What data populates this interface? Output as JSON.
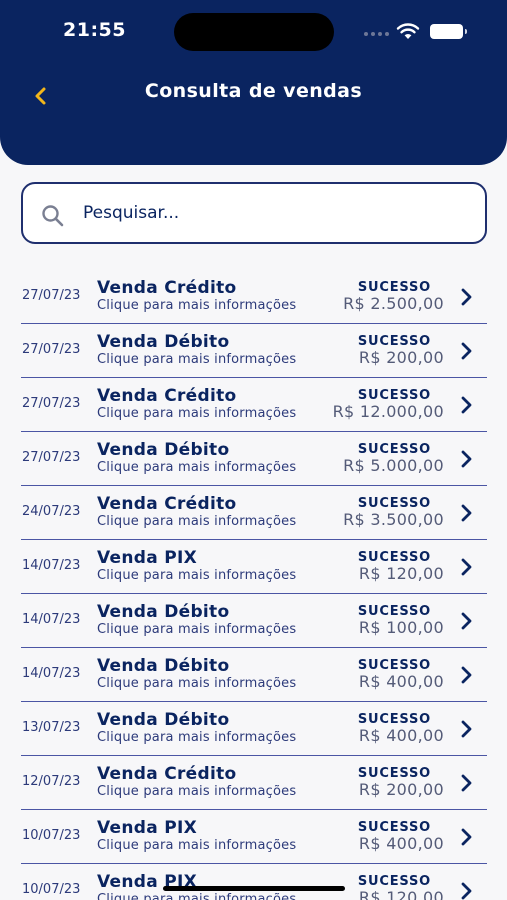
{
  "status_bar": {
    "time": "21:55"
  },
  "header": {
    "title": "Consulta de vendas"
  },
  "search": {
    "placeholder": "Pesquisar..."
  },
  "colors": {
    "primary": "#0a2460",
    "back_arrow": "#f2b61b",
    "divider": "#4b55a4"
  },
  "icons": {
    "back": "chevron-left-icon",
    "search": "search-icon",
    "row": "chevron-right-icon"
  },
  "sales": [
    {
      "date": "27/07/23",
      "type": "Venda Crédito",
      "subtitle": "Clique para mais informações",
      "status": "SUCESSO",
      "amount": "R$ 2.500,00"
    },
    {
      "date": "27/07/23",
      "type": "Venda Débito",
      "subtitle": "Clique para mais informações",
      "status": "SUCESSO",
      "amount": "R$ 200,00"
    },
    {
      "date": "27/07/23",
      "type": "Venda Crédito",
      "subtitle": "Clique para mais informações",
      "status": "SUCESSO",
      "amount": "R$ 12.000,00"
    },
    {
      "date": "27/07/23",
      "type": "Venda Débito",
      "subtitle": "Clique para mais informações",
      "status": "SUCESSO",
      "amount": "R$ 5.000,00"
    },
    {
      "date": "24/07/23",
      "type": "Venda Crédito",
      "subtitle": "Clique para mais informações",
      "status": "SUCESSO",
      "amount": "R$ 3.500,00"
    },
    {
      "date": "14/07/23",
      "type": "Venda PIX",
      "subtitle": "Clique para mais informações",
      "status": "SUCESSO",
      "amount": "R$ 120,00"
    },
    {
      "date": "14/07/23",
      "type": "Venda Débito",
      "subtitle": "Clique para mais informações",
      "status": "SUCESSO",
      "amount": "R$ 100,00"
    },
    {
      "date": "14/07/23",
      "type": "Venda Débito",
      "subtitle": "Clique para mais informações",
      "status": "SUCESSO",
      "amount": "R$ 400,00"
    },
    {
      "date": "13/07/23",
      "type": "Venda Débito",
      "subtitle": "Clique para mais informações",
      "status": "SUCESSO",
      "amount": "R$ 400,00"
    },
    {
      "date": "12/07/23",
      "type": "Venda Crédito",
      "subtitle": "Clique para mais informações",
      "status": "SUCESSO",
      "amount": "R$ 200,00"
    },
    {
      "date": "10/07/23",
      "type": "Venda PIX",
      "subtitle": "Clique para mais informações",
      "status": "SUCESSO",
      "amount": "R$ 400,00"
    },
    {
      "date": "10/07/23",
      "type": "Venda PIX",
      "subtitle": "Clique para mais informações",
      "status": "SUCESSO",
      "amount": "R$ 120,00"
    }
  ]
}
